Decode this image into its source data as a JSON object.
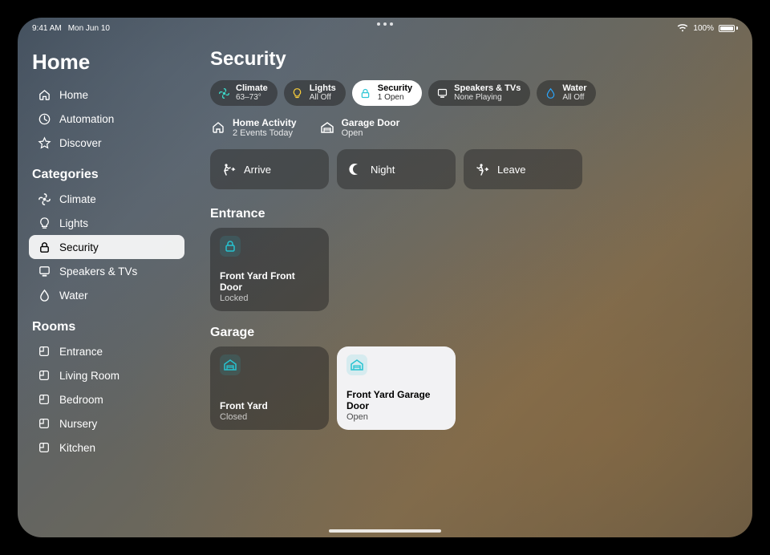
{
  "statusbar": {
    "time": "9:41 AM",
    "date": "Mon Jun 10",
    "battery": "100%"
  },
  "sidebar": {
    "title": "Home",
    "top": [
      {
        "icon": "house-icon",
        "label": "Home"
      },
      {
        "icon": "clock-icon",
        "label": "Automation"
      },
      {
        "icon": "star-icon",
        "label": "Discover"
      }
    ],
    "categories_header": "Categories",
    "categories": [
      {
        "icon": "fan-icon",
        "label": "Climate"
      },
      {
        "icon": "bulb-icon",
        "label": "Lights"
      },
      {
        "icon": "lock-icon",
        "label": "Security",
        "selected": true
      },
      {
        "icon": "device-icon",
        "label": "Speakers & TVs"
      },
      {
        "icon": "drop-icon",
        "label": "Water"
      }
    ],
    "rooms_header": "Rooms",
    "rooms": [
      {
        "icon": "room-icon",
        "label": "Entrance"
      },
      {
        "icon": "room-icon",
        "label": "Living Room"
      },
      {
        "icon": "room-icon",
        "label": "Bedroom"
      },
      {
        "icon": "room-icon",
        "label": "Nursery"
      },
      {
        "icon": "room-icon",
        "label": "Kitchen"
      }
    ]
  },
  "main": {
    "title": "Security",
    "pills": [
      {
        "icon": "fan-icon",
        "color": "#3dd9c9",
        "l1": "Climate",
        "l2": "63–73°"
      },
      {
        "icon": "bulb-icon",
        "color": "#ffd23a",
        "l1": "Lights",
        "l2": "All Off"
      },
      {
        "icon": "lock-icon",
        "color": "#2ec6d6",
        "l1": "Security",
        "l2": "1 Open",
        "active": true
      },
      {
        "icon": "device-icon",
        "color": "#ffffff",
        "l1": "Speakers & TVs",
        "l2": "None Playing"
      },
      {
        "icon": "drop-icon",
        "color": "#2aa7ff",
        "l1": "Water",
        "l2": "All Off"
      }
    ],
    "info": [
      {
        "icon": "house-icon",
        "l1": "Home Activity",
        "l2": "2 Events Today"
      },
      {
        "icon": "garage-icon",
        "l1": "Garage Door",
        "l2": "Open"
      }
    ],
    "scenes": [
      {
        "icon": "arrive-icon",
        "label": "Arrive"
      },
      {
        "icon": "moon-icon",
        "label": "Night"
      },
      {
        "icon": "leave-icon",
        "label": "Leave"
      }
    ],
    "sections": [
      {
        "title": "Entrance",
        "tiles": [
          {
            "icon": "lock-icon",
            "iconbg": "#26c3d1",
            "l1": "Front Yard Front Door",
            "l2": "Locked",
            "light": false
          }
        ]
      },
      {
        "title": "Garage",
        "tiles": [
          {
            "icon": "garage-icon",
            "iconbg": "#26c3d1",
            "l1": "Front Yard",
            "l2": "Closed",
            "light": false
          },
          {
            "icon": "garage-icon",
            "iconbg": "#26c3d1",
            "l1": "Front Yard Garage Door",
            "l2": "Open",
            "light": true
          }
        ]
      }
    ]
  }
}
